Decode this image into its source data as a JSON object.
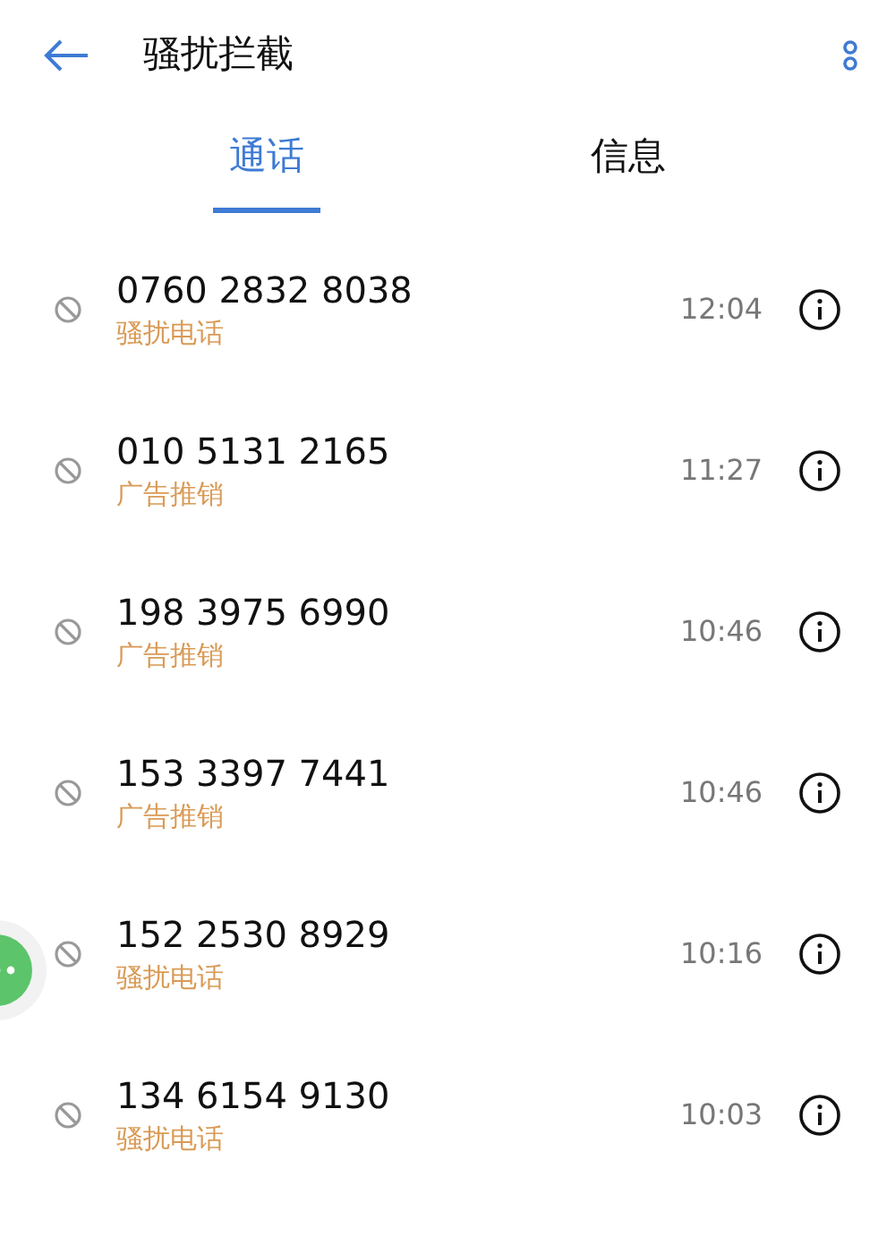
{
  "header": {
    "title": "骚扰拦截"
  },
  "tabs": [
    {
      "label": "通话",
      "selected": true
    },
    {
      "label": "信息",
      "selected": false
    }
  ],
  "calls": [
    {
      "number": "0760 2832 8038",
      "tag": "骚扰电话",
      "time": "12:04"
    },
    {
      "number": "010 5131 2165",
      "tag": "广告推销",
      "time": "11:27"
    },
    {
      "number": "198 3975 6990",
      "tag": "广告推销",
      "time": "10:46"
    },
    {
      "number": "153 3397 7441",
      "tag": "广告推销",
      "time": "10:46"
    },
    {
      "number": "152 2530 8929",
      "tag": "骚扰电话",
      "time": "10:16"
    },
    {
      "number": "134 6154 9130",
      "tag": "骚扰电话",
      "time": "10:03"
    }
  ]
}
